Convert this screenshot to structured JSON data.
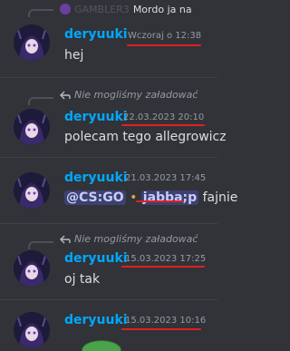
{
  "messages": [
    {
      "reply": {
        "kind": "user",
        "name": "GAMBLER3",
        "text": "Mordo ja na"
      },
      "username": "deryuuki",
      "timestamp": "Wczoraj o 12:38",
      "content": "hej"
    },
    {
      "reply": {
        "kind": "failed",
        "text": "Nie mogliśmy załadować"
      },
      "username": "deryuuki",
      "timestamp": "22.03.2023 20:10",
      "content": "polecam tego allegrowicz"
    },
    {
      "username": "deryuuki",
      "timestamp": "21.03.2023 17:45",
      "mention": "@CS:GO",
      "emoji_text": "jabba;p",
      "content_after": "fajnie"
    },
    {
      "reply": {
        "kind": "failed",
        "text": "Nie mogliśmy załadować"
      },
      "username": "deryuuki",
      "timestamp": "15.03.2023 17:25",
      "content": "oj tak"
    },
    {
      "username": "deryuuki",
      "timestamp": "15.03.2023 10:16"
    }
  ],
  "colors": {
    "background": "#313338",
    "username": "#00a8fc",
    "text": "#dbdee1",
    "timestamp": "#949ba4",
    "annotation_underline": "#e0201f"
  }
}
